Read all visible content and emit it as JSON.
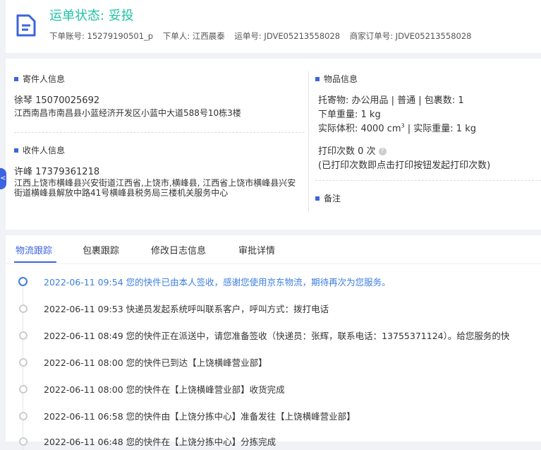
{
  "header": {
    "status": "运单状态: 妥投",
    "account": "下单账号: 15279190501_p",
    "orderer": "下单人: 江西晨泰",
    "waybill": "运单号: JDVE05213558028",
    "merchant_order": "商家订单号: JDVE05213558028"
  },
  "sender": {
    "title": "寄件人信息",
    "name_phone": "徐琴   15070025692",
    "address": "江西南昌市南昌县小蓝经济开发区小蓝中大道588号10栋3楼"
  },
  "receiver": {
    "title": "收件人信息",
    "name_phone": "许峰   17379361218",
    "address": "江西上饶市横峰县兴安街道江西省,上饶市,横峰县, 江西省上饶市横峰县兴安街道横峰县解放中路41号横峰县税务局三楼机关服务中心"
  },
  "goods": {
    "title": "物品信息",
    "line1": "托寄物:  办公用品 | 普通  |  包裹数:  1",
    "line2": "下单重量:   1 kg",
    "volume_prefix": "实际体积:    4000 cm",
    "volume_sup": "3",
    "volume_suffix": " | 实际重量:   1 kg",
    "print_count": "打印次数    0 次",
    "print_note": "(已打印次数即点击打印按钮发起打印次数)",
    "help_icon": "?"
  },
  "remark": {
    "title": "备注"
  },
  "side_tab": "<",
  "tabs": [
    "物流跟踪",
    "包裹跟踪",
    "修改日志信息",
    "审批详情"
  ],
  "timeline": [
    "2022-06-11 09:54  您的快件已由本人签收，感谢您使用京东物流，期待再次为您服务。",
    "2022-06-11 09:53  快递员发起系统呼叫联系客户，呼叫方式：拨打电话",
    "2022-06-11 08:49  您的快件正在派送中，请您准备签收（快递员：张辉，联系电话：13755371124）。给您服务的快",
    "2022-06-11 08:00  您的快件已到达【上饶横峰营业部】",
    "2022-06-11 08:00  您的快件在【上饶横峰营业部】收货完成",
    "2022-06-11 06:58  您的快件由【上饶分拣中心】准备发往【上饶横峰营业部】",
    "2022-06-11 06:48  您的快件在【上饶分拣中心】分拣完成"
  ],
  "colors": {
    "accent": "#3c63e0",
    "status": "#1fc2a6"
  }
}
